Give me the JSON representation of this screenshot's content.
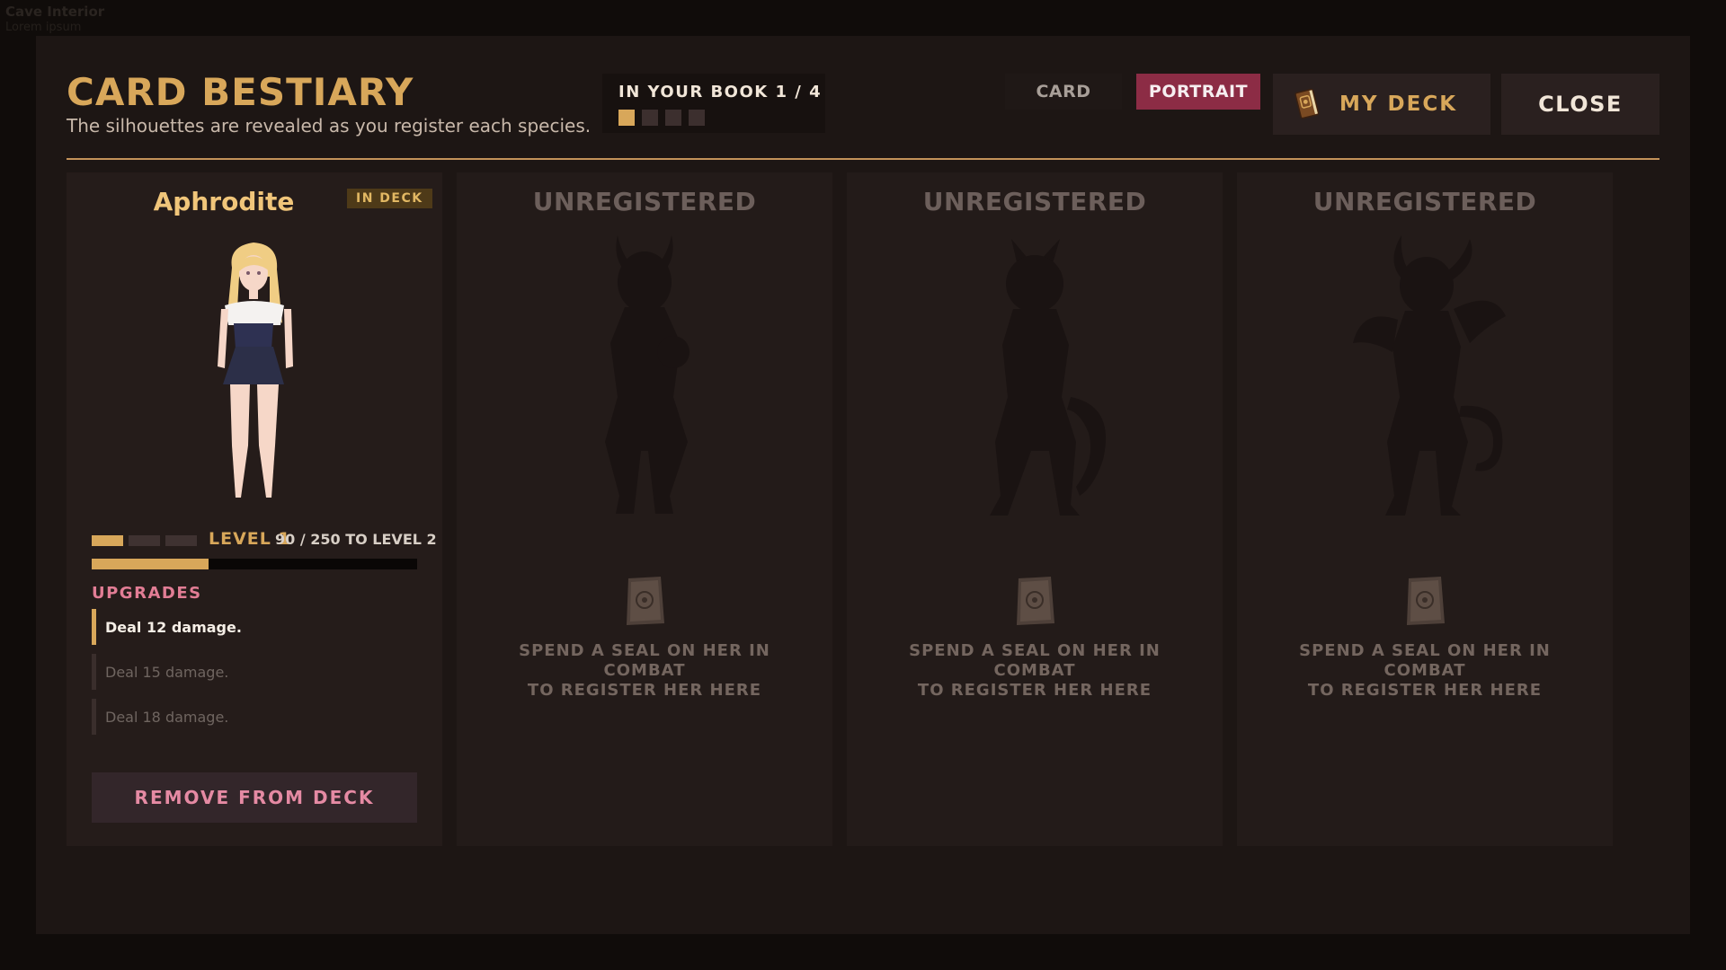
{
  "background": {
    "location_label": "Cave Interior",
    "location_sub": "Lorem ipsum"
  },
  "header": {
    "title": "CARD BESTIARY",
    "subtitle": "The silhouettes are revealed as you register each species."
  },
  "book": {
    "label": "IN YOUR BOOK 1 / 4",
    "registered": 1,
    "total": 4
  },
  "toolbar": {
    "card_label": "CARD",
    "portrait_label": "PORTRAIT",
    "active_mode": "portrait",
    "deck_label": "MY DECK",
    "deck_icon": "book-icon",
    "close_label": "CLOSE"
  },
  "registered_card": {
    "name": "Aphrodite",
    "badge": "IN DECK",
    "portrait": "blonde-girl-portrait",
    "level_pips_filled": 1,
    "level_pips_total": 3,
    "level_label": "LEVEL 1",
    "xp_text": "90 / 250 TO LEVEL 2",
    "xp_current": 90,
    "xp_max": 250,
    "upgrades_title": "UPGRADES",
    "upgrades": [
      {
        "text": "Deal 12 damage.",
        "current": true
      },
      {
        "text": "Deal 15 damage.",
        "current": false
      },
      {
        "text": "Deal 18 damage.",
        "current": false
      }
    ],
    "remove_label": "REMOVE FROM DECK"
  },
  "locked_cards": [
    {
      "title": "UNREGISTERED",
      "silhouette": "horned-girl-silhouette",
      "seal_icon": "seal-icon",
      "hint_line1": "SPEND A SEAL ON HER IN",
      "hint_line2": "COMBAT",
      "hint_line3": "TO REGISTER HER HERE"
    },
    {
      "title": "UNREGISTERED",
      "silhouette": "catgirl-silhouette",
      "seal_icon": "seal-icon",
      "hint_line1": "SPEND A SEAL ON HER IN",
      "hint_line2": "COMBAT",
      "hint_line3": "TO REGISTER HER HERE"
    },
    {
      "title": "UNREGISTERED",
      "silhouette": "succubus-silhouette",
      "seal_icon": "seal-icon",
      "hint_line1": "SPEND A SEAL ON HER IN",
      "hint_line2": "COMBAT",
      "hint_line3": "TO REGISTER HER HERE"
    }
  ],
  "colors": {
    "accent_gold": "#d8a75a",
    "accent_pink": "#e27d95",
    "portrait_active": "#8c2c45",
    "panel": "#1d1614"
  }
}
